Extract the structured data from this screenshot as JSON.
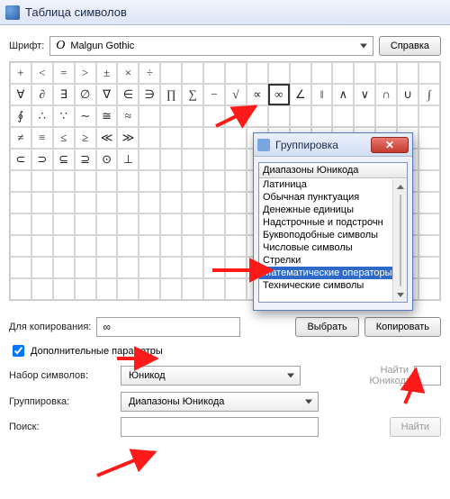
{
  "window": {
    "title": "Таблица символов"
  },
  "font": {
    "label": "Шрифт:",
    "preview_glyph": "O",
    "value": "Malgun Gothic",
    "help_button": "Справка"
  },
  "grid": {
    "cols": 20,
    "rows": 11,
    "selected_char": "∞",
    "chars": [
      "+",
      "<",
      "=",
      ">",
      "±",
      "×",
      "÷",
      "",
      "",
      "",
      "",
      "",
      "",
      "",
      "",
      "",
      "",
      "",
      "",
      "",
      "∀",
      "∂",
      "∃",
      "∅",
      "∇",
      "∈",
      "∋",
      "∏",
      "∑",
      "−",
      "√",
      "∝",
      "∞",
      "∠",
      "‖",
      "∧",
      "∨",
      "∩",
      "∪",
      "∫",
      "∮",
      "∴",
      "∵",
      "∼",
      "≅",
      "≈",
      "",
      "",
      "",
      "",
      "",
      "",
      "",
      "",
      "",
      "",
      "",
      "",
      "",
      "",
      "≠",
      "≡",
      "≤",
      "≥",
      "≪",
      "≫",
      "",
      "",
      "",
      "",
      "",
      "",
      "",
      "",
      "",
      "",
      "",
      "",
      "",
      "",
      "⊂",
      "⊃",
      "⊆",
      "⊇",
      "⊙",
      "⊥",
      "",
      "",
      "",
      "",
      "",
      "",
      "",
      "",
      "",
      "",
      "",
      "",
      "",
      "",
      "",
      "",
      "",
      "",
      "",
      "",
      "",
      "",
      "",
      "",
      "",
      "",
      "",
      "",
      "",
      "",
      "",
      "",
      "",
      "",
      "",
      "",
      "",
      "",
      "",
      "",
      "",
      "",
      "",
      "",
      "",
      "",
      "",
      "",
      "",
      "",
      "",
      "",
      "",
      "",
      "",
      "",
      "",
      "",
      "",
      "",
      "",
      "",
      "",
      "",
      "",
      "",
      "",
      "",
      "",
      "",
      "",
      "",
      "",
      "",
      "",
      "",
      "",
      "",
      "",
      "",
      "",
      "",
      "",
      "",
      "",
      "",
      "",
      "",
      "",
      "",
      "",
      "",
      "",
      "",
      "",
      "",
      "",
      "",
      "",
      "",
      "",
      "",
      "",
      "",
      "",
      "",
      "",
      "",
      "",
      "",
      "",
      "",
      "",
      "",
      "",
      "",
      "",
      "",
      "",
      "",
      "",
      "",
      "",
      "",
      "",
      "",
      "",
      "",
      "",
      "",
      "",
      "",
      "",
      ""
    ]
  },
  "copy_row": {
    "label": "Для копирования:",
    "value": "∞",
    "select_button": "Выбрать",
    "copy_button": "Копировать"
  },
  "advanced": {
    "checkbox_label": "Дополнительные параметры",
    "checked": true
  },
  "charset": {
    "label": "Набор символов:",
    "value": "Юникод",
    "goto_label": "Найти Юникод:"
  },
  "grouping": {
    "label": "Группировка:",
    "value": "Диапазоны Юникода"
  },
  "search": {
    "label": "Поиск:",
    "button": "Найти"
  },
  "popup": {
    "title": "Группировка",
    "list_header": "Диапазоны Юникода",
    "items": [
      "Латиница",
      "Обычная пунктуация",
      "Денежные единицы",
      "Надстрочные и подстрочн",
      "Буквоподобные символы",
      "Числовые символы",
      "Стрелки",
      "Математические операторы",
      "Технические символы"
    ],
    "selected_index": 7
  },
  "annotation": {
    "arrow_color": "#ff1a1a"
  }
}
